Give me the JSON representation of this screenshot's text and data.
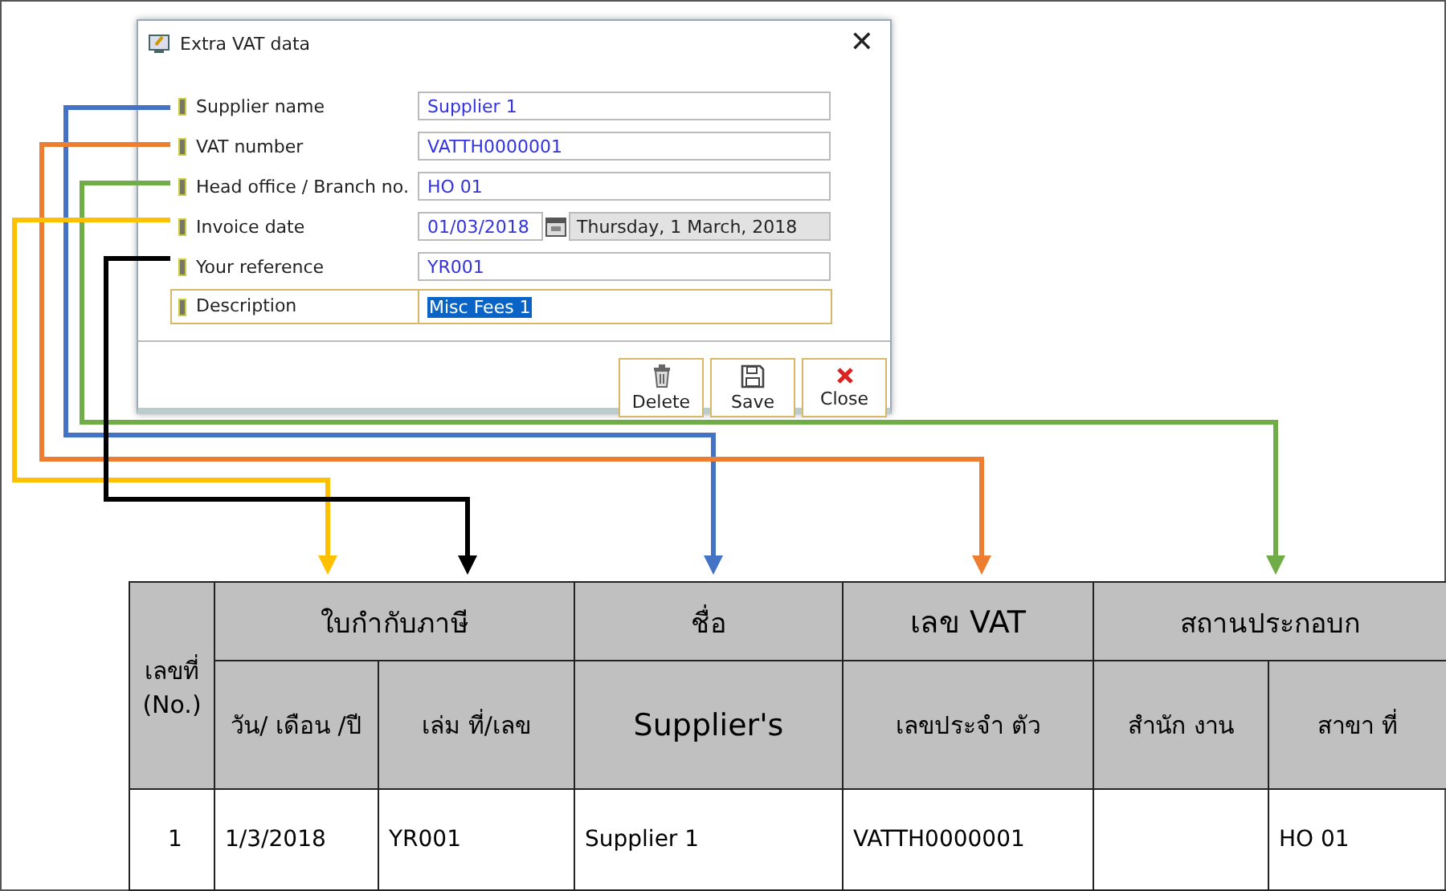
{
  "window": {
    "title": "Extra VAT data",
    "close_glyph": "✕"
  },
  "fields": [
    {
      "kind": "text",
      "label": "Supplier name",
      "value": "Supplier 1",
      "focused": false,
      "color": "#4472c4"
    },
    {
      "kind": "text",
      "label": "VAT number",
      "value": "VATTH0000001",
      "focused": false,
      "color": "#ed7d31"
    },
    {
      "kind": "text",
      "label": "Head office / Branch no.",
      "value": "HO 01",
      "focused": false,
      "color": "#70ad47"
    },
    {
      "kind": "date",
      "label": "Invoice date",
      "value": "01/03/2018",
      "long_date": "Thursday, 1 March, 2018",
      "focused": false,
      "color": "#ffc000"
    },
    {
      "kind": "text",
      "label": "Your reference",
      "value": "YR001",
      "focused": false,
      "color": "#000000"
    },
    {
      "kind": "text",
      "label": "Description",
      "value": "Misc Fees 1",
      "focused": true
    }
  ],
  "buttons": [
    {
      "kind": "delete",
      "label": "Delete"
    },
    {
      "kind": "save",
      "label": "Save"
    },
    {
      "kind": "close",
      "label": "Close"
    }
  ],
  "table": {
    "group_headers": [
      "ใบกำกับภาษี",
      "ชื่อ",
      "เลข VAT",
      "สถานประกอบก"
    ],
    "first_header": "เลขที่ (No.)",
    "sub_headers": [
      "วัน/ เดือน /ปี",
      "เล่ม ที่/เลข",
      "Supplier's",
      "เลขประจำ ตัว",
      "สำนัก งาน",
      "สาขา ที่"
    ],
    "rows": [
      [
        "1",
        "1/3/2018",
        "YR001",
        "Supplier 1",
        "VATTH0000001",
        "",
        "HO 01"
      ]
    ]
  }
}
